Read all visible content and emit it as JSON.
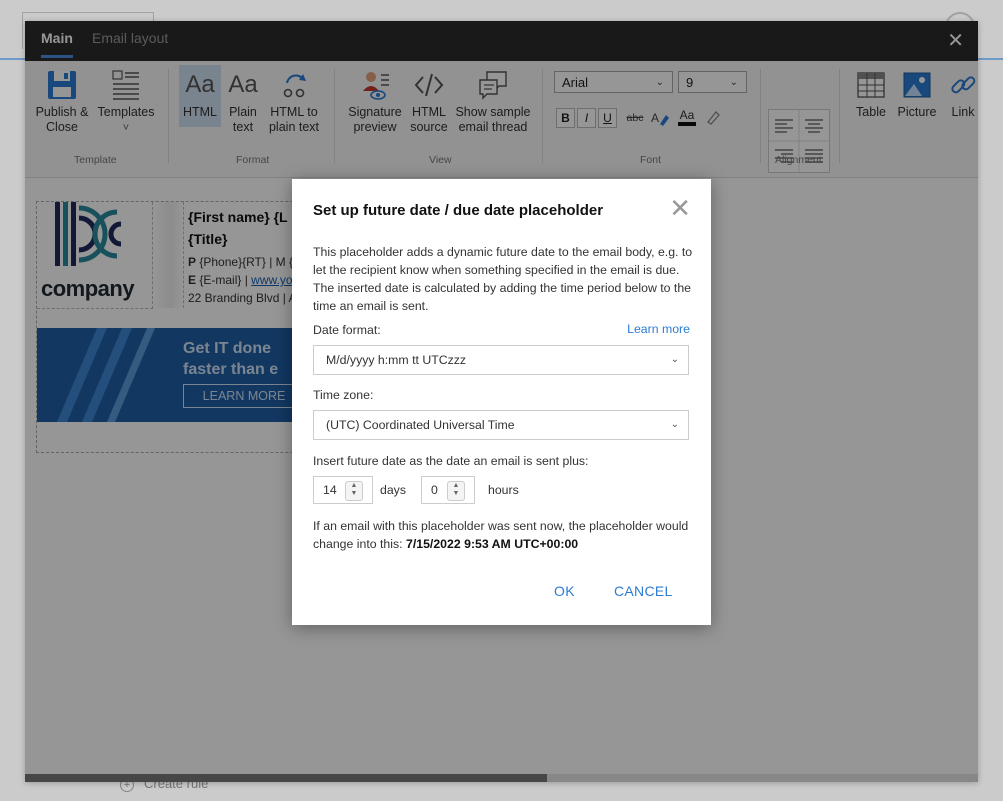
{
  "window": {
    "tabs": [
      {
        "label": "Main"
      },
      {
        "label": "Email layout"
      }
    ],
    "close_label": "✕"
  },
  "ribbon": {
    "template_group": {
      "label": "Template",
      "publish_line1": "Publish &",
      "publish_line2": "Close",
      "templates_label": "Templates",
      "templates_arrow": "˅"
    },
    "format_group": {
      "label": "Format",
      "html_glyph": "Aa",
      "html_label": "HTML",
      "plain_glyph": "Aa",
      "plain_line1": "Plain",
      "plain_line2": "text",
      "h2p_line1": "HTML to",
      "h2p_line2": "plain text"
    },
    "view_group": {
      "label": "View",
      "sigprev_line1": "Signature",
      "sigprev_line2": "preview",
      "src_line1": "HTML",
      "src_line2": "source",
      "thread_line1": "Show sample",
      "thread_line2": "email thread"
    },
    "font_group": {
      "label": "Font",
      "font_family": "Arial",
      "font_size": "9",
      "bold": "B",
      "italic": "I",
      "underline": "U",
      "strike": "abc",
      "font_color_glyph": "Aa"
    },
    "alignment_group": {
      "label": "Alignment"
    },
    "insert_group": {
      "table": "Table",
      "picture": "Picture",
      "link": "Link"
    }
  },
  "signature": {
    "logo_word": "company",
    "name_line1": "{First name} {L",
    "name_line2": "{Title}",
    "line1_prefix": "P",
    "line1_rest": "{Phone}{RT} | M {",
    "line2_prefix": "E",
    "line2_rest": "{E-mail} | ",
    "line2_link": "www.yo",
    "line3": "22 Branding Blvd | A",
    "banner_line1": "Get IT done",
    "banner_line2": "faster than e",
    "banner_button": "LEARN MORE"
  },
  "background": {
    "create_rule": "Create rule"
  },
  "modal": {
    "title": "Set up future date / due date placeholder",
    "close_label": "✕",
    "description": "This placeholder adds a dynamic future date to the email body, e.g. to let the recipient know when something specified in the email is due. The inserted date is calculated by adding the time period below to the time an email is sent.",
    "date_format_label": "Date format:",
    "learn_more": "Learn more",
    "date_format_value": "M/d/yyyy h:mm tt UTCzzz",
    "time_zone_label": "Time zone:",
    "time_zone_value": "(UTC) Coordinated Universal Time",
    "offset_label": "Insert future date as the date an email is sent plus:",
    "days_value": "14",
    "days_unit": "days",
    "hours_value": "0",
    "hours_unit": "hours",
    "preview_text": "If an email with this placeholder was sent now, the placeholder would change into this:",
    "preview_value": "7/15/2022 9:53 AM UTC+00:00",
    "ok_label": "OK",
    "cancel_label": "CANCEL"
  },
  "colors": {
    "accent": "#2b7cd3",
    "titlebar": "#2b2b2b",
    "banner": "#1f5fa6",
    "logo_teal": "#2a8a9a",
    "logo_navy": "#1f2a5a"
  }
}
